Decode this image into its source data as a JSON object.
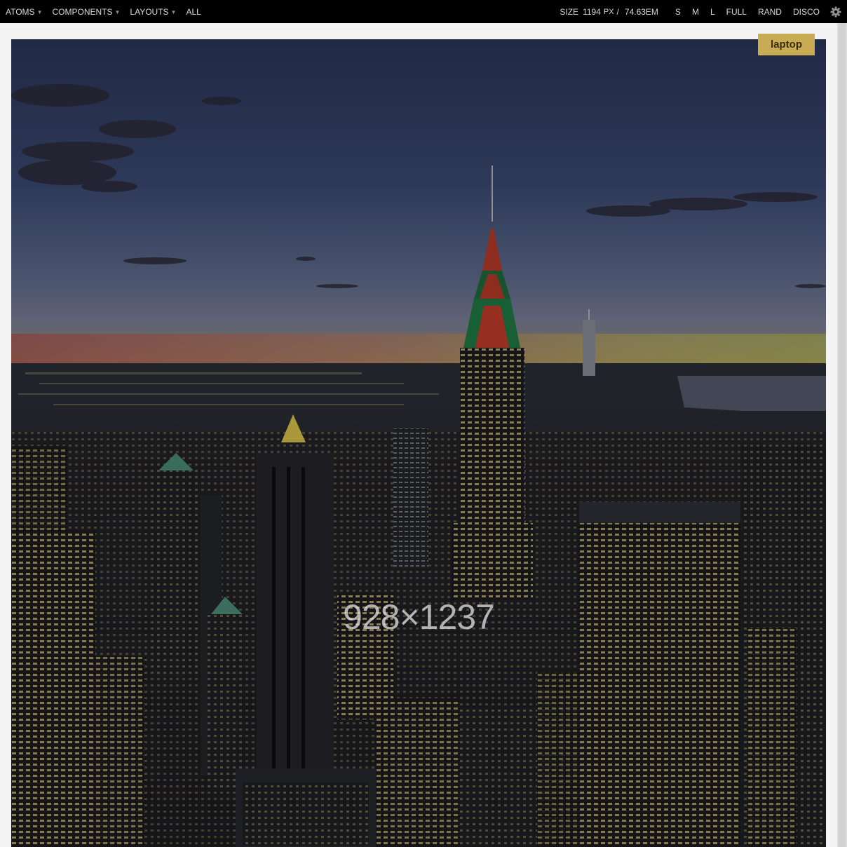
{
  "toolbar": {
    "nav": [
      {
        "label": "ATOMS",
        "has_menu": true
      },
      {
        "label": "COMPONENTS",
        "has_menu": true
      },
      {
        "label": "LAYOUTS",
        "has_menu": true
      },
      {
        "label": "ALL",
        "has_menu": false
      }
    ],
    "size_label": "SIZE",
    "size_px_value": "1194",
    "size_px_unit": "PX",
    "size_separator": "/",
    "size_em": "74.63EM",
    "size_buttons": [
      "S",
      "M",
      "L",
      "FULL",
      "RAND",
      "DISCO"
    ],
    "settings_icon": "gear-icon"
  },
  "viewport": {
    "badge": "laptop",
    "image_caption": "928×1237"
  },
  "colors": {
    "toolbar_bg": "#000000",
    "toolbar_text": "#d8d8d8",
    "badge_bg": "#c9ad55",
    "page_bg": "#f4f4f4"
  }
}
